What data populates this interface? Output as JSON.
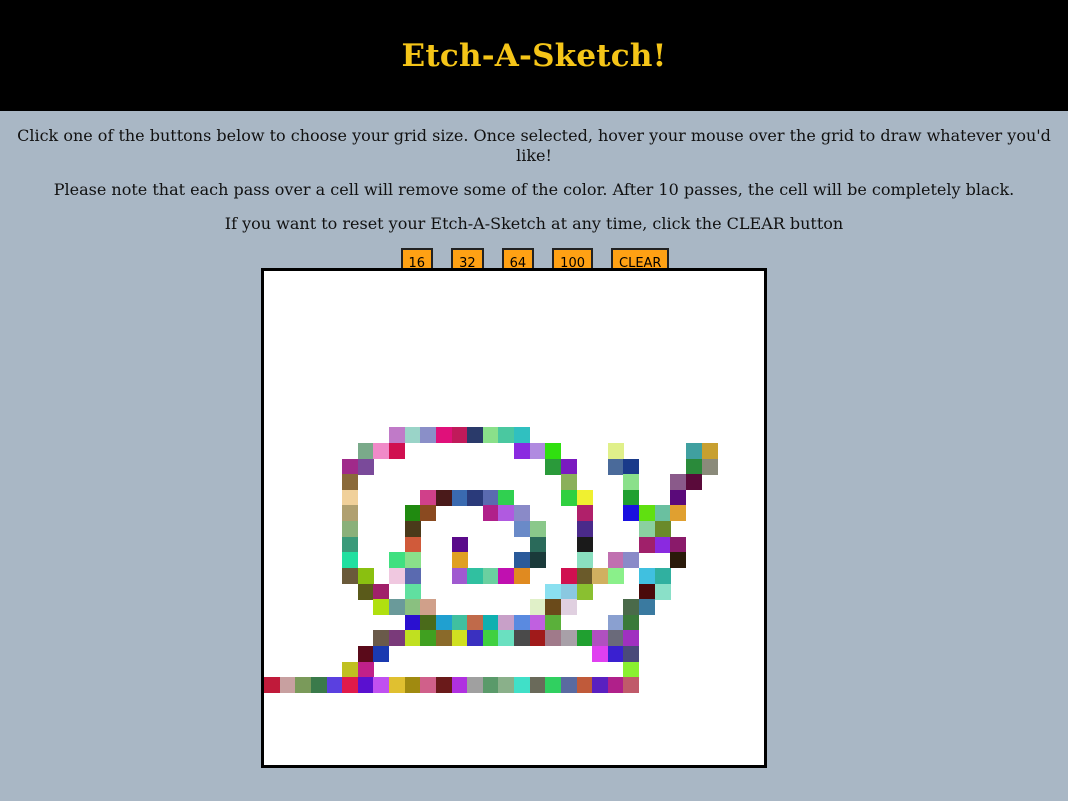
{
  "header": {
    "title": "Etch-A-Sketch!"
  },
  "instructions": {
    "line1": "Click one of the buttons below to choose your grid size. Once selected, hover your mouse over the grid to draw whatever you'd like!",
    "line2": "Please note that each pass over a cell will remove some of the color. After 10 passes, the cell will be completely black.",
    "line3": "If you want to reset your Etch-A-Sketch at any time, click the CLEAR button"
  },
  "buttons": {
    "size16": "16",
    "size32": "32",
    "size64": "64",
    "size100": "100",
    "clear": "CLEAR"
  },
  "grid": {
    "size": 32,
    "background": "#ffffff",
    "painted_cells": [
      [
        10,
        8,
        "#c07ac8"
      ],
      [
        10,
        9,
        "#9ad4c8"
      ],
      [
        10,
        10,
        "#8a8fc8"
      ],
      [
        10,
        11,
        "#e0107a"
      ],
      [
        10,
        12,
        "#c01a5a"
      ],
      [
        10,
        13,
        "#2a3a6a"
      ],
      [
        10,
        14,
        "#8ae08a"
      ],
      [
        10,
        15,
        "#4ac8a0"
      ],
      [
        10,
        16,
        "#30c0c0"
      ],
      [
        11,
        6,
        "#7aaa8a"
      ],
      [
        11,
        7,
        "#f08ac8"
      ],
      [
        11,
        8,
        "#d01050"
      ],
      [
        11,
        16,
        "#8a2ae0"
      ],
      [
        11,
        17,
        "#b08ae0"
      ],
      [
        11,
        18,
        "#30e010"
      ],
      [
        11,
        22,
        "#e0f08a"
      ],
      [
        11,
        27,
        "#40a0a0"
      ],
      [
        11,
        28,
        "#c8a030"
      ],
      [
        12,
        5,
        "#a02a8a"
      ],
      [
        12,
        6,
        "#7a4a9a"
      ],
      [
        12,
        18,
        "#2a9a3a"
      ],
      [
        12,
        19,
        "#7a1ac0"
      ],
      [
        12,
        22,
        "#4a6a9a"
      ],
      [
        12,
        23,
        "#1a3a8a"
      ],
      [
        12,
        27,
        "#2a8a3a"
      ],
      [
        12,
        28,
        "#8a8a7a"
      ],
      [
        13,
        5,
        "#8a6a3a"
      ],
      [
        13,
        19,
        "#8ab05a"
      ],
      [
        13,
        23,
        "#8ae08a"
      ],
      [
        13,
        26,
        "#8a5a8a"
      ],
      [
        13,
        27,
        "#5a0a3a"
      ],
      [
        14,
        5,
        "#f0d09a"
      ],
      [
        14,
        10,
        "#d0408a"
      ],
      [
        14,
        11,
        "#4a1a1a"
      ],
      [
        14,
        12,
        "#3a6ab0"
      ],
      [
        14,
        13,
        "#2a3a7a"
      ],
      [
        14,
        14,
        "#5a6ab0"
      ],
      [
        14,
        15,
        "#30d050"
      ],
      [
        14,
        19,
        "#30d040"
      ],
      [
        14,
        20,
        "#f0f030"
      ],
      [
        14,
        23,
        "#20a030"
      ],
      [
        14,
        26,
        "#5a0a7a"
      ],
      [
        15,
        5,
        "#b0a070"
      ],
      [
        15,
        9,
        "#208a10"
      ],
      [
        15,
        10,
        "#8a4a20"
      ],
      [
        15,
        14,
        "#b0208a"
      ],
      [
        15,
        15,
        "#b05ae0"
      ],
      [
        15,
        16,
        "#8a8ac8"
      ],
      [
        15,
        20,
        "#b0206a"
      ],
      [
        15,
        23,
        "#1a10e0"
      ],
      [
        15,
        24,
        "#60e010"
      ],
      [
        15,
        25,
        "#6ac0a0"
      ],
      [
        15,
        26,
        "#e0a030"
      ],
      [
        16,
        5,
        "#8ab07a"
      ],
      [
        16,
        9,
        "#4a3a1a"
      ],
      [
        16,
        16,
        "#6a8ac8"
      ],
      [
        16,
        17,
        "#8ac88a"
      ],
      [
        16,
        20,
        "#4a2a8a"
      ],
      [
        16,
        24,
        "#8ad0a0"
      ],
      [
        16,
        25,
        "#6a8a2a"
      ],
      [
        17,
        5,
        "#3a9a7a"
      ],
      [
        17,
        9,
        "#d05a3a"
      ],
      [
        17,
        12,
        "#5a0a8a"
      ],
      [
        17,
        17,
        "#2a6a5a"
      ],
      [
        17,
        20,
        "#1a1a1a"
      ],
      [
        17,
        24,
        "#a0206a"
      ],
      [
        17,
        25,
        "#8a2ae0"
      ],
      [
        17,
        26,
        "#8a1a6a"
      ],
      [
        18,
        5,
        "#20e0a0"
      ],
      [
        18,
        8,
        "#40e080"
      ],
      [
        18,
        9,
        "#8ae08a"
      ],
      [
        18,
        12,
        "#e0a020"
      ],
      [
        18,
        16,
        "#2a5a9a"
      ],
      [
        18,
        17,
        "#1a3a3a"
      ],
      [
        18,
        20,
        "#8ae0c0"
      ],
      [
        18,
        22,
        "#c070b0"
      ],
      [
        18,
        23,
        "#8a8ac8"
      ],
      [
        18,
        26,
        "#2a1a0a"
      ],
      [
        19,
        5,
        "#6a5a3a"
      ],
      [
        19,
        6,
        "#8ac010"
      ],
      [
        19,
        8,
        "#f0c8e0"
      ],
      [
        19,
        9,
        "#5a6ab0"
      ],
      [
        19,
        12,
        "#a05ad0"
      ],
      [
        19,
        13,
        "#30c0a0"
      ],
      [
        19,
        14,
        "#6ad0a0"
      ],
      [
        19,
        15,
        "#c010b0"
      ],
      [
        19,
        16,
        "#e08a20"
      ],
      [
        19,
        19,
        "#d01050"
      ],
      [
        19,
        20,
        "#6a5a2a"
      ],
      [
        19,
        21,
        "#d0b060"
      ],
      [
        19,
        22,
        "#8af08a"
      ],
      [
        19,
        24,
        "#40c0e0"
      ],
      [
        19,
        25,
        "#30b0a0"
      ],
      [
        20,
        6,
        "#5a5a1a"
      ],
      [
        20,
        7,
        "#a0206a"
      ],
      [
        20,
        9,
        "#60e0a0"
      ],
      [
        20,
        18,
        "#8ae0f0"
      ],
      [
        20,
        19,
        "#8ac8e0"
      ],
      [
        20,
        20,
        "#8ac030"
      ],
      [
        20,
        24,
        "#4a0a0a"
      ],
      [
        20,
        25,
        "#8ae0c8"
      ],
      [
        21,
        7,
        "#b0e010"
      ],
      [
        21,
        8,
        "#6a9a9a"
      ],
      [
        21,
        9,
        "#8ac080"
      ],
      [
        21,
        10,
        "#d0a08a"
      ],
      [
        21,
        17,
        "#e0f0c8"
      ],
      [
        21,
        18,
        "#6a4a1a"
      ],
      [
        21,
        19,
        "#e0d0e0"
      ],
      [
        21,
        23,
        "#4a6a4a"
      ],
      [
        21,
        24,
        "#3a7aa0"
      ],
      [
        22,
        9,
        "#2a10d0"
      ],
      [
        22,
        10,
        "#4a6a1a"
      ],
      [
        22,
        11,
        "#20a0d0"
      ],
      [
        22,
        12,
        "#40c0a0"
      ],
      [
        22,
        13,
        "#c06a4a"
      ],
      [
        22,
        14,
        "#10b0b0"
      ],
      [
        22,
        15,
        "#c8a0c8"
      ],
      [
        22,
        16,
        "#5a8ae0"
      ],
      [
        22,
        17,
        "#c060e0"
      ],
      [
        22,
        18,
        "#5ab03a"
      ],
      [
        22,
        22,
        "#8aa0d0"
      ],
      [
        22,
        23,
        "#3a7a3a"
      ],
      [
        23,
        7,
        "#6a5a4a"
      ],
      [
        23,
        8,
        "#7a3a7a"
      ],
      [
        23,
        9,
        "#c0e020"
      ],
      [
        23,
        10,
        "#40a020"
      ],
      [
        23,
        11,
        "#8a6a2a"
      ],
      [
        23,
        12,
        "#d0e020"
      ],
      [
        23,
        13,
        "#3a30c0"
      ],
      [
        23,
        14,
        "#40d040"
      ],
      [
        23,
        15,
        "#6ae0c0"
      ],
      [
        23,
        16,
        "#4a4a4a"
      ],
      [
        23,
        17,
        "#a01a1a"
      ],
      [
        23,
        18,
        "#a07a8a"
      ],
      [
        23,
        19,
        "#a8a0a8"
      ],
      [
        23,
        20,
        "#20a030"
      ],
      [
        23,
        21,
        "#b050c0"
      ],
      [
        23,
        22,
        "#6a6a7a"
      ],
      [
        23,
        23,
        "#a030c0"
      ],
      [
        24,
        6,
        "#5a0a1a"
      ],
      [
        24,
        7,
        "#1a3ab0"
      ],
      [
        24,
        21,
        "#e040f0"
      ],
      [
        24,
        22,
        "#3a20d0"
      ],
      [
        24,
        23,
        "#4a4a7a"
      ],
      [
        25,
        5,
        "#c0c020"
      ],
      [
        25,
        6,
        "#c0208a"
      ],
      [
        25,
        23,
        "#8af030"
      ],
      [
        26,
        0,
        "#c01a3a"
      ],
      [
        26,
        1,
        "#c8a0a0"
      ],
      [
        26,
        2,
        "#7a9a5a"
      ],
      [
        26,
        3,
        "#3a7a4a"
      ],
      [
        26,
        4,
        "#5a40e0"
      ],
      [
        26,
        5,
        "#e01a4a"
      ],
      [
        26,
        6,
        "#5a10d0"
      ],
      [
        26,
        7,
        "#c050f0"
      ],
      [
        26,
        8,
        "#e0c030"
      ],
      [
        26,
        9,
        "#a08a10"
      ],
      [
        26,
        10,
        "#d0608a"
      ],
      [
        26,
        11,
        "#6a1a1a"
      ],
      [
        26,
        12,
        "#b030e0"
      ],
      [
        26,
        13,
        "#a0a0a0"
      ],
      [
        26,
        14,
        "#5a9a6a"
      ],
      [
        26,
        15,
        "#8ab08a"
      ],
      [
        26,
        16,
        "#40e0c8"
      ],
      [
        26,
        17,
        "#6a6a5a"
      ],
      [
        26,
        18,
        "#30d060"
      ],
      [
        26,
        19,
        "#5a6aa0"
      ],
      [
        26,
        20,
        "#c05a3a"
      ],
      [
        26,
        21,
        "#5a20c0"
      ],
      [
        26,
        22,
        "#b0208a"
      ],
      [
        26,
        23,
        "#c05a6a"
      ]
    ]
  }
}
